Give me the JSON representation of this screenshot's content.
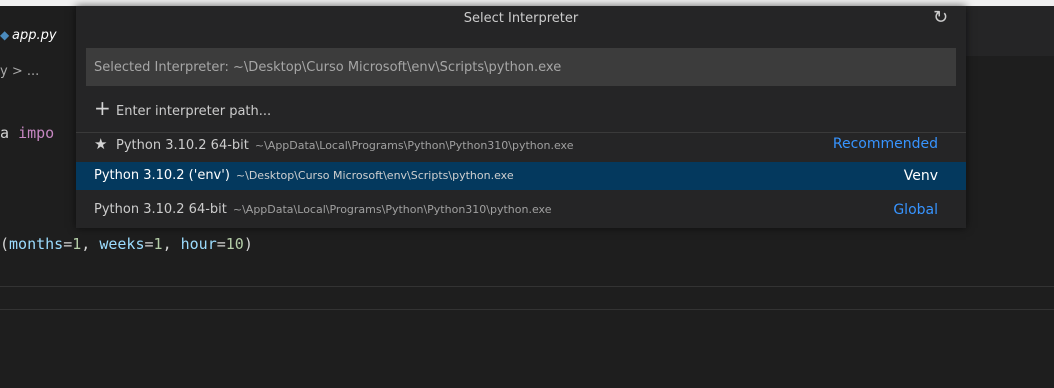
{
  "editor": {
    "tab_label": "app.py",
    "breadcrumb": "y > ...",
    "code_line1": {
      "prefix": "a ",
      "keyword": "impo"
    },
    "code_line2": {
      "open": "(",
      "p1": "months",
      "eq1": "=",
      "v1": "1",
      "sep1": ", ",
      "p2": "weeks",
      "eq2": "=",
      "v2": "1",
      "sep2": ", ",
      "p3": "hour",
      "eq3": "=",
      "v3": "10",
      "close": ")"
    }
  },
  "quickpick": {
    "title": "Select Interpreter",
    "refresh_icon": "refresh-icon",
    "input_placeholder": "Selected Interpreter: ~\\Desktop\\Curso Microsoft\\env\\Scripts\\python.exe",
    "items": [
      {
        "icon": "+",
        "label": "Enter interpreter path...",
        "description": "",
        "detail": ""
      },
      {
        "icon": "★",
        "label": "Python 3.10.2 64-bit",
        "description": "~\\AppData\\Local\\Programs\\Python\\Python310\\python.exe",
        "detail": "Recommended"
      },
      {
        "icon": "",
        "label": "Python 3.10.2 ('env')",
        "description": "~\\Desktop\\Curso Microsoft\\env\\Scripts\\python.exe",
        "detail": "Venv"
      },
      {
        "icon": "",
        "label": "Python 3.10.2 64-bit",
        "description": "~\\AppData\\Local\\Programs\\Python\\Python310\\python.exe",
        "detail": "Global"
      }
    ]
  },
  "colors": {
    "selection": "#04395e",
    "recommended": "#3794ff",
    "global": "#3794ff"
  }
}
